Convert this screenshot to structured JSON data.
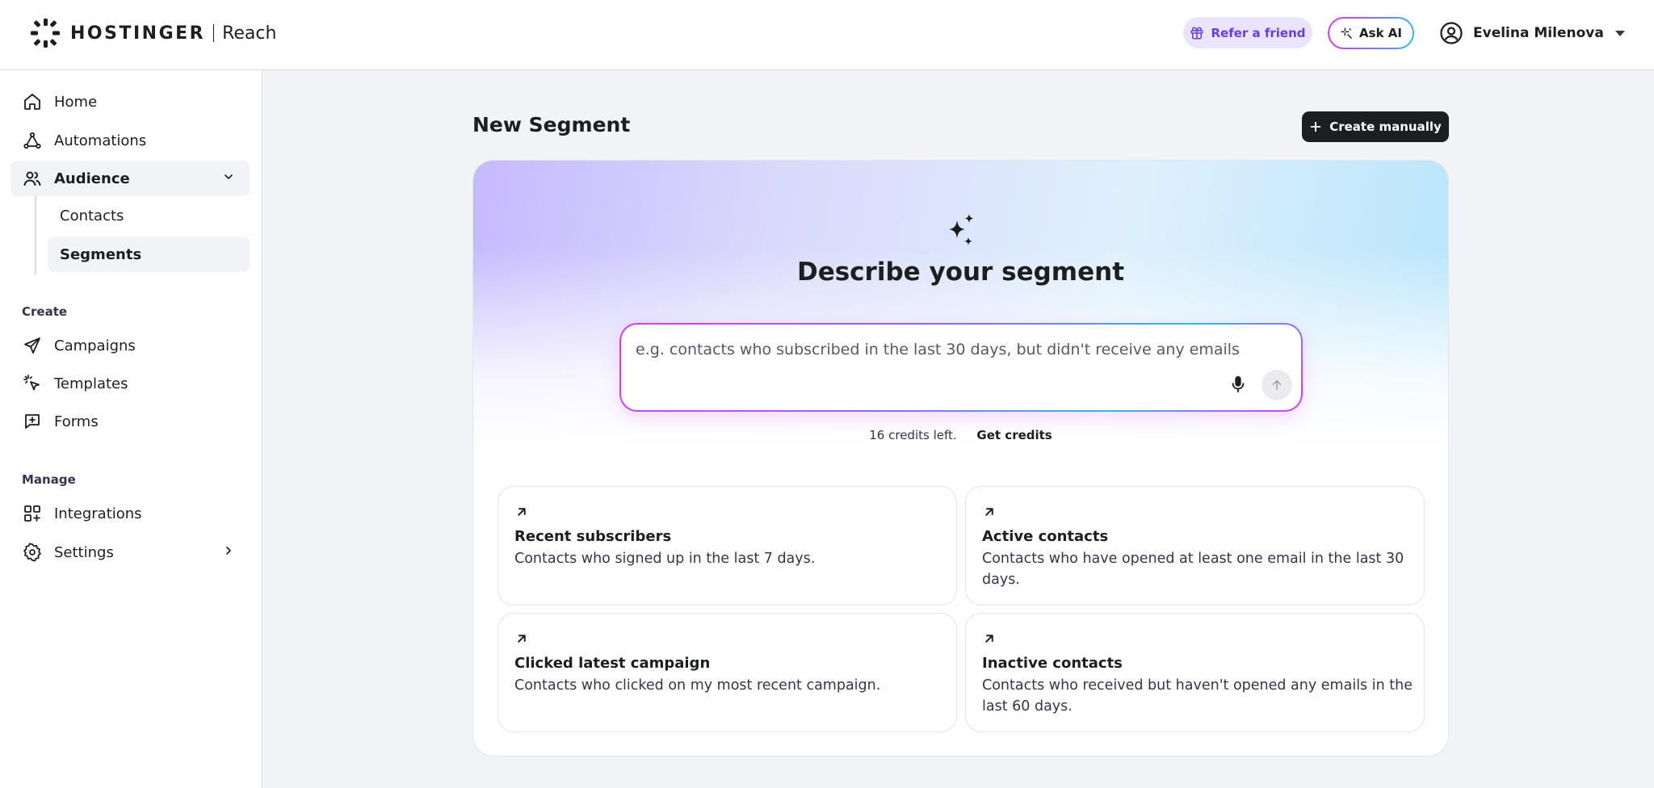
{
  "header": {
    "brand": "HOSTINGER",
    "product": "Reach",
    "refer_label": "Refer a friend",
    "ask_ai_label": "Ask AI",
    "user_name": "Evelina Milenova"
  },
  "sidebar": {
    "items": [
      {
        "label": "Home",
        "icon": "home-icon"
      },
      {
        "label": "Automations",
        "icon": "automations-icon"
      },
      {
        "label": "Audience",
        "icon": "users-icon"
      }
    ],
    "audience_sub": [
      {
        "label": "Contacts"
      },
      {
        "label": "Segments"
      }
    ],
    "create_section": "Create",
    "create_items": [
      {
        "label": "Campaigns",
        "icon": "send-icon"
      },
      {
        "label": "Templates",
        "icon": "cursor-click-icon"
      },
      {
        "label": "Forms",
        "icon": "form-icon"
      }
    ],
    "manage_section": "Manage",
    "manage_items": [
      {
        "label": "Integrations",
        "icon": "grid-plus-icon"
      },
      {
        "label": "Settings",
        "icon": "gear-icon"
      }
    ]
  },
  "main": {
    "title": "New Segment",
    "create_manually_label": "Create manually",
    "hero_title": "Describe your segment",
    "prompt_placeholder": "e.g. contacts who subscribed in the last 30 days, but didn't receive any emails",
    "credits_text": "16 credits left.",
    "get_credits_label": "Get credits",
    "suggestions": [
      {
        "title": "Recent subscribers",
        "desc": "Contacts who signed up in the last 7 days."
      },
      {
        "title": "Active contacts",
        "desc": "Contacts who have opened at least one email in the last 30 days."
      },
      {
        "title": "Clicked latest campaign",
        "desc": "Contacts who clicked on my most recent campaign."
      },
      {
        "title": "Inactive contacts",
        "desc": "Contacts who received but haven't opened any emails in the last 60 days."
      }
    ]
  },
  "colors": {
    "accent": "#673de6",
    "dark": "#1d1e20",
    "page_bg": "#f2f3f6"
  }
}
